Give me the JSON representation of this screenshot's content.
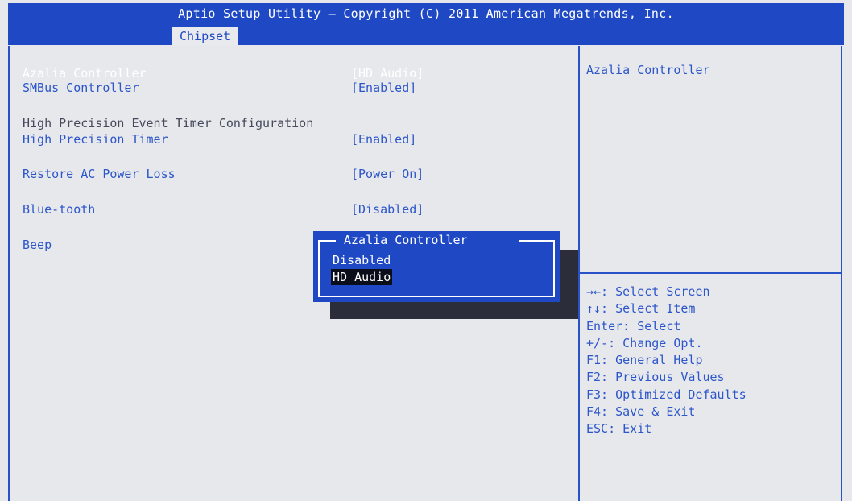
{
  "header": {
    "title": "Aptio Setup Utility – Copyright (C) 2011 American Megatrends, Inc.",
    "active_tab": "Chipset"
  },
  "settings": {
    "azalia": {
      "label": "Azalia Controller",
      "value": "[HD Audio]"
    },
    "smbus": {
      "label": "SMBus Controller",
      "value": "[Enabled]"
    },
    "hpet_section": "High Precision Event Timer Configuration",
    "hpet": {
      "label": "High Precision Timer",
      "value": "[Enabled]"
    },
    "restore_ac": {
      "label": "Restore AC Power Loss",
      "value": "[Power On]"
    },
    "bluetooth": {
      "label": "Blue-tooth",
      "value": "[Disabled]"
    },
    "beep": {
      "label": "Beep"
    }
  },
  "help": {
    "title": "Azalia Controller",
    "keys": [
      "→←: Select Screen",
      "↑↓: Select Item",
      "Enter: Select",
      "+/-: Change Opt.",
      "F1: General Help",
      "F2: Previous Values",
      "F3: Optimized Defaults",
      "F4: Save & Exit",
      "ESC: Exit"
    ]
  },
  "popup": {
    "title": "Azalia Controller",
    "options": [
      "Disabled",
      "HD Audio"
    ],
    "selected": "HD Audio"
  },
  "colors": {
    "background": "#e7e8ec",
    "header_blue": "#1f49c4",
    "item_blue": "#2c56c9",
    "highlight": "#0a0d1a"
  }
}
